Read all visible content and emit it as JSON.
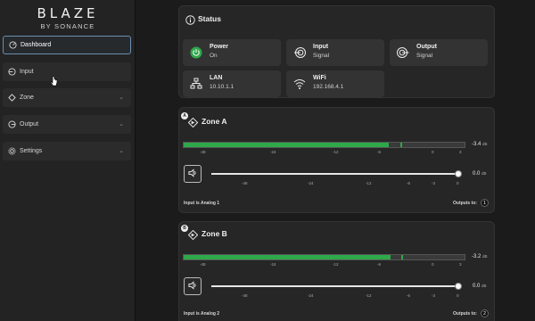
{
  "brand": {
    "name": "BLAZE",
    "sub": "BY SONANCE"
  },
  "sidebar": {
    "items": [
      {
        "label": "Dashboard",
        "icon": "dashboard-icon",
        "active": true
      },
      {
        "label": "Input",
        "icon": "input-icon"
      },
      {
        "label": "Zone",
        "icon": "zone-icon"
      },
      {
        "label": "Output",
        "icon": "output-icon"
      },
      {
        "label": "Settings",
        "icon": "gear-icon"
      }
    ]
  },
  "status": {
    "title": "Status",
    "cards": [
      {
        "label": "Power",
        "value": "On",
        "icon": "power-icon",
        "color": "#2ea84a"
      },
      {
        "label": "Input",
        "value": "Signal",
        "icon": "input-signal-icon"
      },
      {
        "label": "Output",
        "value": "Signal",
        "icon": "output-signal-icon"
      },
      {
        "label": "LAN",
        "value": "10.10.1.1",
        "icon": "lan-icon"
      },
      {
        "label": "WiFi",
        "value": "192.168.4.1",
        "icon": "wifi-icon"
      }
    ]
  },
  "meter_ticks": [
    "-48",
    "-24",
    "-12",
    "-6",
    "0",
    "3"
  ],
  "slider_ticks": [
    "-48",
    "-24",
    "-12",
    "-6",
    "-3",
    "0"
  ],
  "zones": [
    {
      "letter": "A",
      "title": "Zone A",
      "meter_level_fraction": 0.73,
      "meter_peak_fraction": 0.77,
      "meter_db": "-3.4",
      "meter_unit": "dB",
      "volume_db": "0.0",
      "volume_unit": "dB",
      "volume_fraction": 1.0,
      "input_text": "Input is Analog 1",
      "outputs_label": "Outputs to:",
      "outputs_count": "1"
    },
    {
      "letter": "B",
      "title": "Zone B",
      "meter_level_fraction": 0.735,
      "meter_peak_fraction": 0.775,
      "meter_db": "-3.2",
      "meter_unit": "dB",
      "volume_db": "0.0",
      "volume_unit": "dB",
      "volume_fraction": 1.0,
      "input_text": "Input is Analog 2",
      "outputs_label": "Outputs to:",
      "outputs_count": "2"
    }
  ],
  "colors": {
    "accent": "#2ea84a",
    "active_border": "#6b8fb0"
  }
}
